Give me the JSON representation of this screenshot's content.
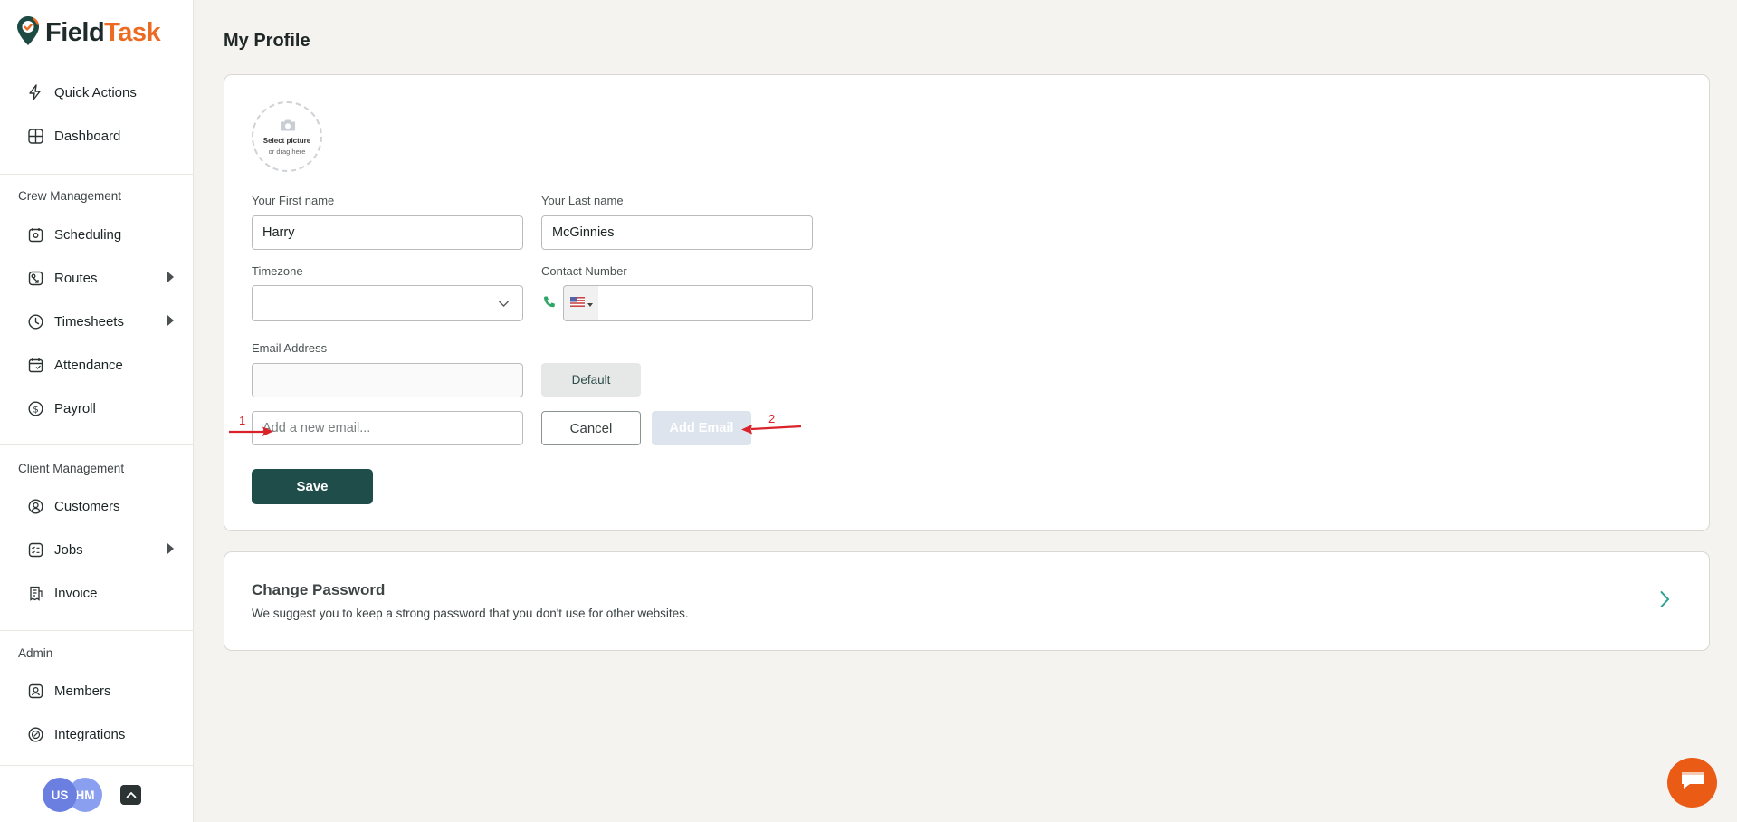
{
  "brand": {
    "part1": "Field",
    "part2": "Task"
  },
  "sidebar": {
    "top_items": [
      {
        "label": "Quick Actions",
        "icon": "lightning-icon"
      },
      {
        "label": "Dashboard",
        "icon": "dashboard-icon"
      }
    ],
    "sections": [
      {
        "title": "Crew Management",
        "items": [
          {
            "label": "Scheduling",
            "icon": "scheduling-icon"
          },
          {
            "label": "Routes",
            "icon": "routes-icon",
            "expandable": true
          },
          {
            "label": "Timesheets",
            "icon": "clock-icon",
            "expandable": true
          },
          {
            "label": "Attendance",
            "icon": "calendar-icon"
          },
          {
            "label": "Payroll",
            "icon": "dollar-icon"
          }
        ]
      },
      {
        "title": "Client Management",
        "items": [
          {
            "label": "Customers",
            "icon": "user-circle-icon"
          },
          {
            "label": "Jobs",
            "icon": "jobs-icon",
            "expandable": true
          },
          {
            "label": "Invoice",
            "icon": "invoice-icon"
          }
        ]
      },
      {
        "title": "Admin",
        "items": [
          {
            "label": "Members",
            "icon": "members-icon"
          },
          {
            "label": "Integrations",
            "icon": "integrations-icon"
          }
        ]
      }
    ],
    "avatars": [
      "US",
      "HM"
    ]
  },
  "page": {
    "title": "My Profile"
  },
  "profile": {
    "photo_line1": "Select picture",
    "photo_line2": "or drag here",
    "first_name_label": "Your First name",
    "first_name_value": "Harry",
    "last_name_label": "Your Last name",
    "last_name_value": "McGinnies",
    "timezone_label": "Timezone",
    "timezone_value": "",
    "contact_label": "Contact Number",
    "contact_value": "",
    "email_label": "Email Address",
    "email_value": "",
    "default_label": "Default",
    "new_email_placeholder": "Add a new email...",
    "cancel_label": "Cancel",
    "add_email_label": "Add Email",
    "save_label": "Save"
  },
  "password": {
    "title": "Change Password",
    "description": "We suggest you to keep a strong password that you don't use for other websites."
  },
  "annotations": [
    "1",
    "2"
  ],
  "colors": {
    "brand_orange": "#ec6a21",
    "primary_green": "#1f4d49",
    "annotation_red": "#d9222a",
    "chat_orange": "#ea5b16"
  }
}
